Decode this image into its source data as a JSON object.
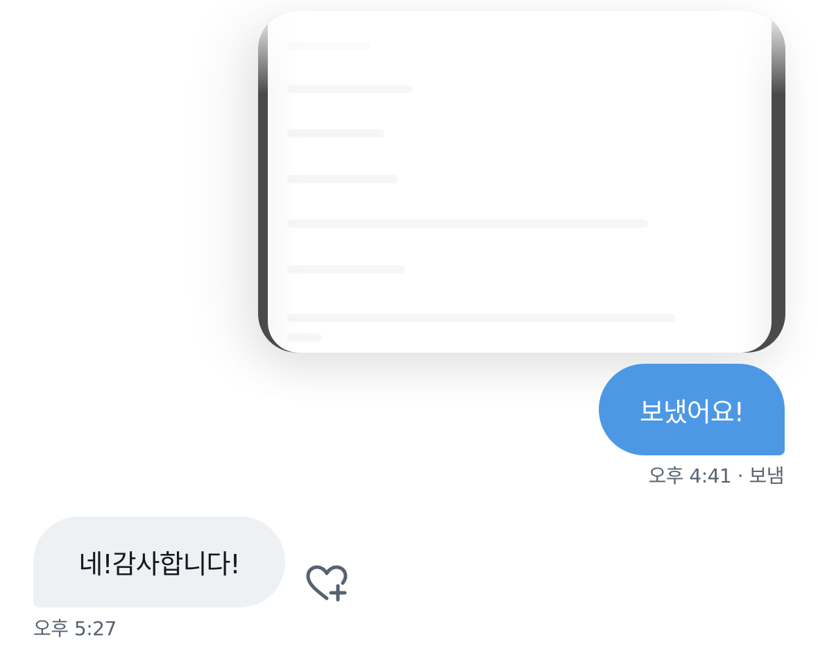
{
  "conversation": {
    "sent_message": {
      "text": "보냈어요!",
      "time": "오후 4:41",
      "status": "· 보냄"
    },
    "received_message": {
      "text": "네!감사합니다!",
      "time": "오후 5:27"
    },
    "react_button": {
      "icon": "heart-plus-icon"
    }
  },
  "colors": {
    "sent_bubble": "#4c98e5",
    "received_bubble": "#eef1f3",
    "meta_text": "#566270"
  }
}
